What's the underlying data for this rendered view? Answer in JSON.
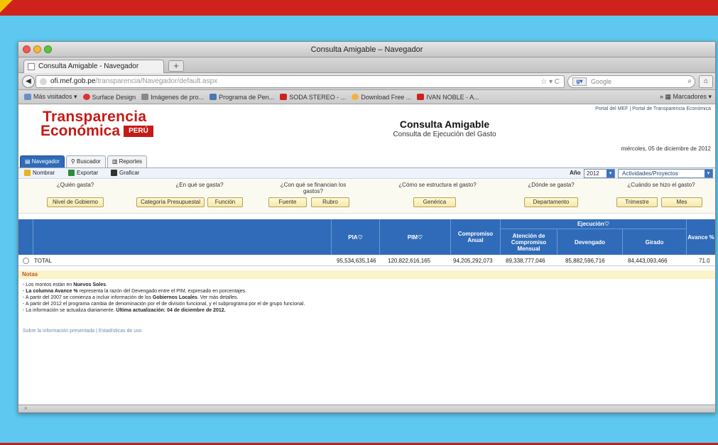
{
  "window": {
    "title": "Consulta Amigable – Navegador"
  },
  "tab": {
    "label": "Consulta Amigable - Navegador",
    "new_tab": "+"
  },
  "nav": {
    "url_host": "ofi.mef.gob.pe",
    "url_path": "/transparencia/Navegador/default.aspx",
    "search_engine": "Google",
    "back_icon": "back-arrow-icon"
  },
  "bookmarks": {
    "items": [
      {
        "label": "Más visitados ▾",
        "color": "#6a8fc7"
      },
      {
        "label": "Surface Design",
        "color": "#d33"
      },
      {
        "label": "Imágenes de pro...",
        "color": "#888"
      },
      {
        "label": "Programa de Pen...",
        "color": "#4a78b0"
      },
      {
        "label": "SODA STEREO - ...",
        "color": "#c22"
      },
      {
        "label": "Download Free ...",
        "color": "#f0b43c"
      },
      {
        "label": "IVAN NOBLE - A...",
        "color": "#c22"
      }
    ],
    "right_label": "Marcadores ▾"
  },
  "header": {
    "logo_line1": "Transparencia",
    "logo_line2": "Económica",
    "logo_badge": "PERÚ",
    "title": "Consulta Amigable",
    "subtitle": "Consulta de Ejecución del Gasto",
    "top_links": "Portal del MEF  |  Portal de Transparencia Económica",
    "date": "miércoles, 05 de diciembre de 2012"
  },
  "view_tabs": [
    "Navegador",
    "Buscador",
    "Reportes"
  ],
  "actions": {
    "nombrar": "Nombrar",
    "exportar": "Exportar",
    "graficar": "Graficar",
    "year_label": "Año",
    "year_value": "2012",
    "view_select": "Actividades/Proyectos"
  },
  "questions": [
    {
      "text": "¿Quién gasta?",
      "buttons": [
        "Nivel de Gobierno"
      ]
    },
    {
      "text": "¿En qué se gasta?",
      "buttons": [
        "Categoría Presupuestal",
        "Función"
      ]
    },
    {
      "text": "¿Con qué se financian los gastos?",
      "buttons": [
        "Fuente",
        "Rubro"
      ]
    },
    {
      "text": "¿Cómo se estructura el gasto?",
      "buttons": [
        "Genérica"
      ]
    },
    {
      "text": "¿Dónde se gasta?",
      "buttons": [
        "Departamento"
      ]
    },
    {
      "text": "¿Cuándo se hizo el gasto?",
      "buttons": [
        "Trimestre",
        "Mes"
      ]
    }
  ],
  "table": {
    "headers": {
      "pia": "PIA",
      "pim": "PIM",
      "compromiso_anual": "Compromiso Anual",
      "ejecucion": "Ejecución",
      "atencion": "Atención de Compromiso Mensual",
      "devengado": "Devengado",
      "girado": "Girado",
      "avance": "Avance %"
    },
    "total_row": {
      "label": "TOTAL",
      "pia": "95,534,635,146",
      "pim": "120,822,616,165",
      "compromiso_anual": "94,205,292,073",
      "atencion": "89,338,777,046",
      "devengado": "85,882,596,716",
      "girado": "84,443,093,466",
      "avance": "71.0"
    }
  },
  "notes": {
    "title": "Notas",
    "lines": [
      {
        "pre": "- Los montos están en ",
        "bold": "Nuevos Soles",
        "post": "."
      },
      {
        "pre": "- ",
        "bold": "La columna Avance %",
        "post": " representa la razón del Devengado entre el PIM, expresado en porcentajes."
      },
      {
        "pre": "- A partir del 2007 se comienza a incluir información de los ",
        "bold": "Gobiernos Locales",
        "post": ". Ver más detalles."
      },
      {
        "pre": "- A partir del 2012 el programa cambia de denominación por el de división funcional, y el subprograma por el de grupo funcional.",
        "bold": "",
        "post": ""
      },
      {
        "pre": "- La información se actualiza diariamente. ",
        "bold": "Última actualización: 04 de diciembre de 2012.",
        "post": ""
      }
    ],
    "links": "Sobre la información presentada  |  Estadísticas de uso"
  },
  "status": {
    "text": "×"
  }
}
